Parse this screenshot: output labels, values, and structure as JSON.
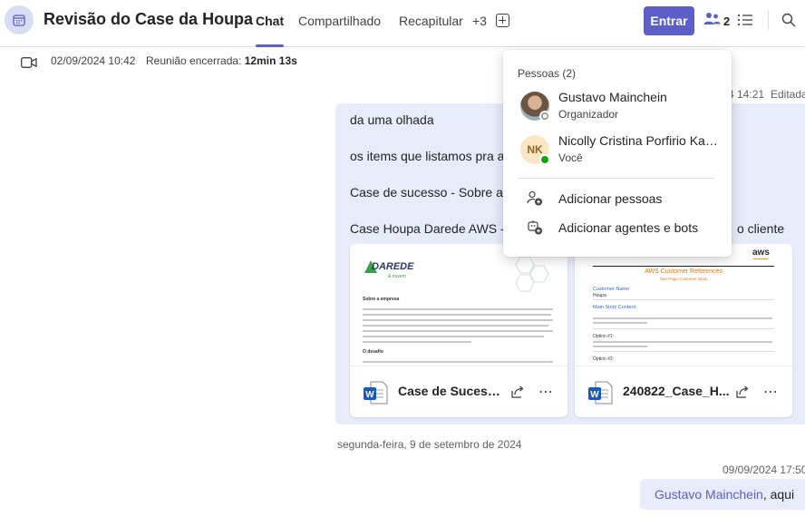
{
  "header": {
    "title": "Revisão do Case da Houpa",
    "tabs": [
      {
        "label": "Chat"
      },
      {
        "label": "Compartilhado"
      },
      {
        "label": "Recapitular"
      },
      {
        "label": "+3"
      }
    ],
    "join_label": "Entrar",
    "people_count": "2"
  },
  "meeting": {
    "date": "02/09/2024 10:42",
    "status_prefix": "Reunião encerrada: ",
    "duration": "12min 13s"
  },
  "message1": {
    "time": "4 14:21",
    "edited": "Editada",
    "lines": [
      "da uma olhada",
      "os items que listamos pra a",
      "Case de sucesso - Sobre a e",
      "Case Houpa Darede AWS -",
      "o cliente"
    ],
    "attachments": [
      {
        "name": "Case de Sucesso...",
        "preview_logo": "DAREDE",
        "preview_logo_sub": "& nuvem",
        "preview_heading": "Sobre a empresa",
        "preview_heading2": "O desafio"
      },
      {
        "name": "240822_Case_H...",
        "preview_logo": "aws",
        "preview_title": "AWS Customer References",
        "preview_subtitle": "Two-Page Customer Story",
        "preview_field1": "Customer Name",
        "preview_value1": "Houpa",
        "preview_field2": "Main Story Content",
        "preview_option1": "Option #1:",
        "preview_option2": "Option #2:"
      }
    ]
  },
  "date_separator": "segunda-feira, 9 de setembro de 2024",
  "message2": {
    "time": "09/09/2024 17:50",
    "mention": "Gustavo Mainchein",
    "text": ", aqui"
  },
  "people_popover": {
    "title": "Pessoas (2)",
    "people": [
      {
        "name": "Gustavo Mainchein",
        "role": "Organizador",
        "status_color": "#8a8886"
      },
      {
        "name": "Nicolly Cristina Porfirio Kas...",
        "role": "Você",
        "initials": "NK",
        "status_color": "#13a10e"
      }
    ],
    "actions": [
      {
        "label": "Adicionar pessoas",
        "icon": "add-person-icon"
      },
      {
        "label": "Adicionar agentes e bots",
        "icon": "add-bot-icon"
      }
    ]
  },
  "colors": {
    "accent": "#5b5fc7",
    "bubble": "#e8ebfa",
    "word_blue": "#185abd"
  }
}
